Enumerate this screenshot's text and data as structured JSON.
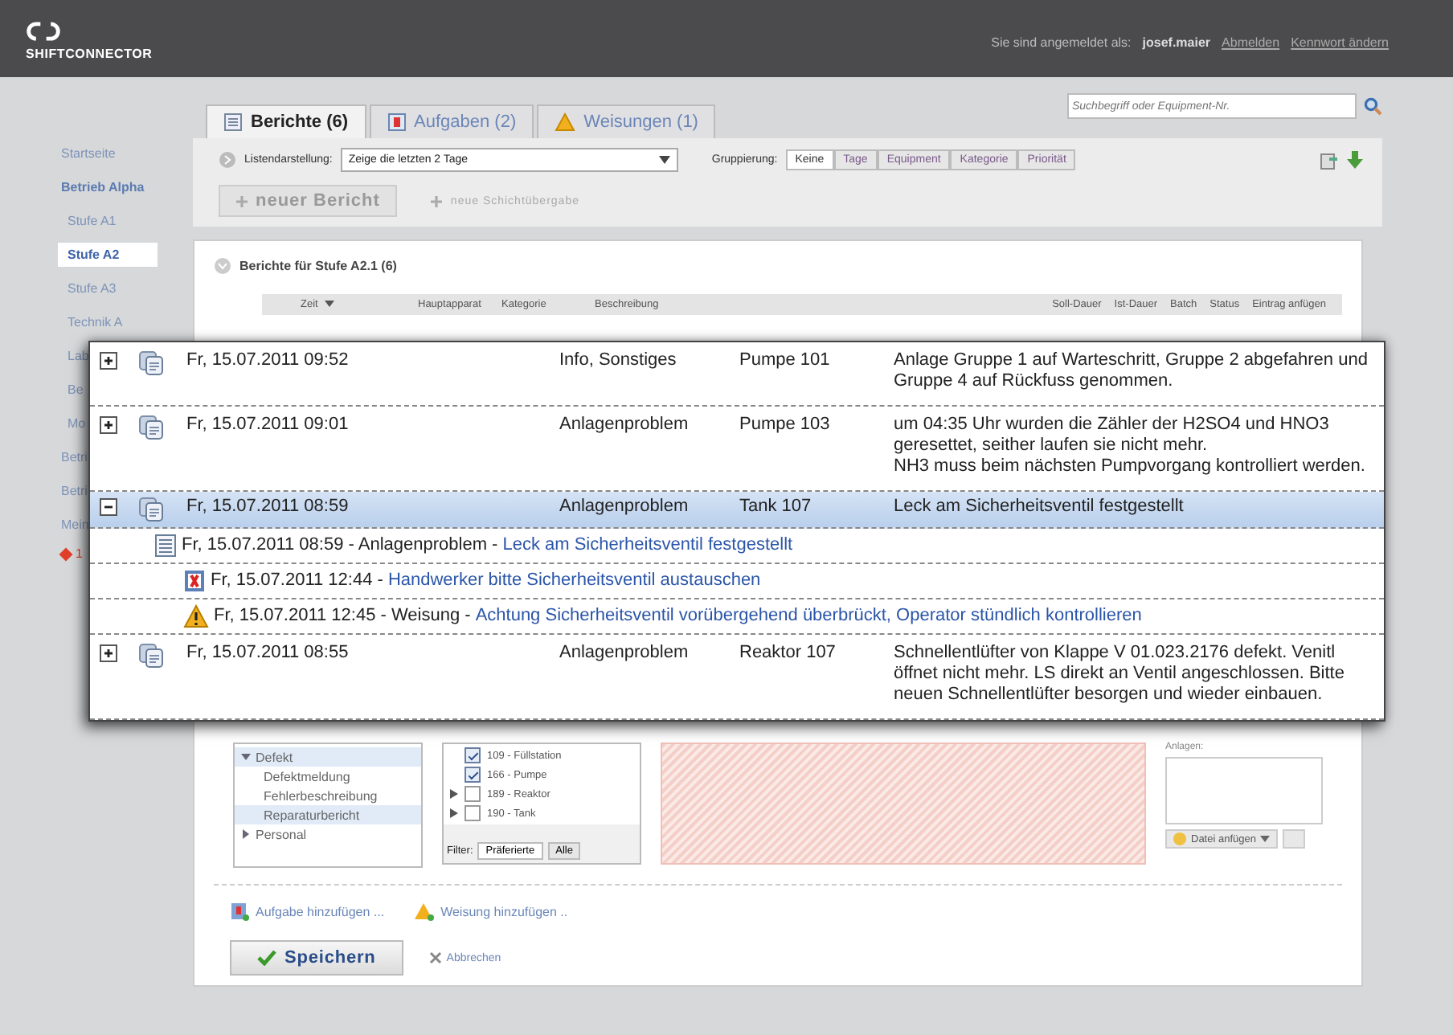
{
  "header": {
    "product": "SHIFTCONNECTOR",
    "login_label": "Sie sind angemeldet als:",
    "user": "josef.maier",
    "links": [
      "Abmelden",
      "Kennwort ändern"
    ]
  },
  "sidebar": {
    "items": [
      {
        "label": "Startseite",
        "kind": "link",
        "selected": false
      },
      {
        "label": "Betrieb Alpha",
        "kind": "group",
        "selected": false
      },
      {
        "label": "Stufe A1",
        "kind": "sub",
        "selected": false
      },
      {
        "label": "Stufe A2",
        "kind": "sub",
        "selected": true
      },
      {
        "label": "Stufe A3",
        "kind": "sub",
        "selected": false
      },
      {
        "label": "Technik A",
        "kind": "sub",
        "selected": false
      },
      {
        "label": "Lab",
        "kind": "sub",
        "selected": false
      },
      {
        "label": "Be",
        "kind": "sub",
        "selected": false
      },
      {
        "label": "Mo",
        "kind": "sub",
        "selected": false
      },
      {
        "label": "Betri",
        "kind": "link",
        "selected": false
      },
      {
        "label": "Betri",
        "kind": "link",
        "selected": false
      },
      {
        "label": "Mein",
        "kind": "link",
        "selected": false
      },
      {
        "label": "1",
        "kind": "alert"
      }
    ]
  },
  "tabs": [
    {
      "label": "Berichte (6)",
      "selected": true
    },
    {
      "label": "Aufgaben (2)",
      "selected": false
    },
    {
      "label": "Weisungen (1)",
      "selected": false
    }
  ],
  "search": {
    "placeholder": "Suchbegriff oder Equipment-Nr."
  },
  "toolbar": {
    "list_label": "Listendarstellung:",
    "list_value": "Zeige die letzten 2 Tage",
    "grouping_label": "Gruppierung:",
    "grouping": [
      {
        "label": "Keine",
        "selected": true
      },
      {
        "label": "Tage",
        "selected": false
      },
      {
        "label": "Equipment",
        "selected": false
      },
      {
        "label": "Kategorie",
        "selected": false
      },
      {
        "label": "Priorität",
        "selected": false
      }
    ]
  },
  "actions": [
    {
      "label": "neuer Bericht",
      "disabled": false
    },
    {
      "label": "neue Schichtübergabe",
      "disabled": true
    }
  ],
  "panel": {
    "title": "Berichte für Stufe A2.1 (6)",
    "columns": [
      {
        "label": "Zeit",
        "sorted": true
      },
      {
        "label": "Hauptapparat",
        "sorted": false
      },
      {
        "label": "Kategorie",
        "sorted": false
      },
      {
        "label": "Beschreibung",
        "sorted": false
      }
    ],
    "columns_right": [
      "Soll-Dauer",
      "Ist-Dauer",
      "Batch",
      "Status",
      "Eintrag anfügen"
    ]
  },
  "popup": {
    "rows": [
      {
        "kind": "report",
        "time": "Fr, 15.07.2011 09:52",
        "category": "Info, Sonstiges",
        "equipment": "Pumpe 101",
        "description": [
          "Anlage Gruppe 1 auf Warteschritt, Gruppe 2 abgefahren und Gruppe 4 auf Rückfuss genommen."
        ],
        "expanded": false,
        "selected": false
      },
      {
        "kind": "report",
        "time": "Fr, 15.07.2011 09:01",
        "category": "Anlagenproblem",
        "equipment": "Pumpe 103",
        "description": [
          "um 04:35 Uhr wurden die Zähler der H2SO4 und HNO3 geresettet, seither laufen sie nicht mehr.",
          "NH3 muss beim nächsten Pumpvorgang kontrolliert werden."
        ],
        "expanded": false,
        "selected": false
      },
      {
        "kind": "report",
        "time": "Fr, 15.07.2011 08:59",
        "category": "Anlagenproblem",
        "equipment": "Tank 107",
        "description": [
          "Leck am Sicherheitsventil festgestellt"
        ],
        "expanded": true,
        "selected": true
      },
      {
        "kind": "note",
        "head": "Fr, 15.07.2011 08:59 - Anlagenproblem - ",
        "link": "Leck am Sicherheitsventil festgestellt"
      },
      {
        "kind": "task",
        "head": "Fr, 15.07.2011 12:44 - ",
        "link": "Handwerker bitte Sicherheitsventil austauschen"
      },
      {
        "kind": "instruction",
        "head": "Fr, 15.07.2011 12:45 - Weisung - ",
        "link": "Achtung Sicherheitsventil vorübergehend überbrückt, Operator stündlich kontrollieren"
      },
      {
        "kind": "report",
        "time": "Fr, 15.07.2011 08:55",
        "category": "Anlagenproblem",
        "equipment": "Reaktor 107",
        "description": [
          "Schnellentlüfter von Klappe V 01.023.2176 defekt. Venitl öffnet nicht mehr. LS direkt an Ventil angeschlossen. Bitte neuen Schnellentlüfter besorgen und wieder einbauen."
        ],
        "expanded": false,
        "selected": false
      }
    ]
  },
  "form": {
    "categories": [
      {
        "label": "Defekt",
        "expanded": true,
        "selected": true,
        "children": [
          {
            "label": "Defektmeldung",
            "selected": false
          },
          {
            "label": "Fehlerbeschreibung",
            "selected": false
          },
          {
            "label": "Reparaturbericht",
            "selected": true
          }
        ]
      },
      {
        "label": "Personal",
        "expanded": false,
        "selected": false
      }
    ],
    "equipment": [
      {
        "label": "109 - Füllstation",
        "checked": true,
        "has_children": false
      },
      {
        "label": "166 - Pumpe",
        "checked": true,
        "has_children": false
      },
      {
        "label": "189 - Reaktor",
        "checked": false,
        "has_children": true
      },
      {
        "label": "190 - Tank",
        "checked": false,
        "has_children": true
      }
    ],
    "filter_label": "Filter:",
    "filters": [
      {
        "label": "Präferierte",
        "selected": true
      },
      {
        "label": "Alle",
        "selected": false
      }
    ],
    "attachments_label": "Anlagen:",
    "attach_button": "Datei anfügen"
  },
  "footer": {
    "links": [
      {
        "label": "Aufgabe hinzufügen ..."
      },
      {
        "label": "Weisung hinzufügen .."
      }
    ],
    "save": "Speichern",
    "cancel": "Abbrechen"
  }
}
